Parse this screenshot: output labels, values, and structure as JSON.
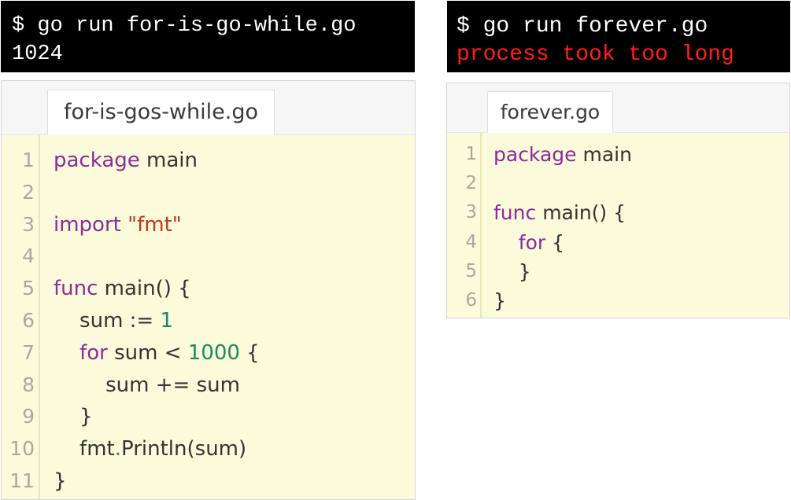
{
  "left_terminal": {
    "command": "$ go run for-is-go-while.go",
    "output": "1024"
  },
  "right_terminal": {
    "command": "$ go run forever.go",
    "output": "process took too long"
  },
  "left_editor": {
    "tab_label": "for-is-gos-while.go",
    "line_numbers": [
      "1",
      "2",
      "3",
      "4",
      "5",
      "6",
      "7",
      "8",
      "9",
      "10",
      "11"
    ],
    "tokens": {
      "l1_kw": "package",
      "l1_rest": " main",
      "l3_kw": "import",
      "l3_sp": " ",
      "l3_str": "\"fmt\"",
      "l5_kw": "func",
      "l5_rest": " main() {",
      "l6_pre": "    sum := ",
      "l6_num": "1",
      "l7_ind": "    ",
      "l7_kw": "for",
      "l7_mid": " sum < ",
      "l7_num": "1000",
      "l7_end": " {",
      "l8": "        sum += sum",
      "l9": "    }",
      "l10_pkg": "    fmt",
      "l10_dot": ".",
      "l10_rest": "Println(sum)",
      "l11": "}"
    }
  },
  "right_editor": {
    "tab_label": "forever.go",
    "line_numbers": [
      "1",
      "2",
      "3",
      "4",
      "5",
      "6"
    ],
    "tokens": {
      "l1_kw": "package",
      "l1_rest": " main",
      "l3_kw": "func",
      "l3_rest": " main() {",
      "l4_ind": "    ",
      "l4_kw": "for",
      "l4_rest": " {",
      "l5": "    }",
      "l6": "}"
    }
  },
  "colors": {
    "terminal_bg": "#000000",
    "terminal_error": "#ff1f1f",
    "editor_bg": "#fbfbdc",
    "keyword": "#8e2a9c",
    "string": "#c3371c",
    "number": "#1a8a64"
  }
}
